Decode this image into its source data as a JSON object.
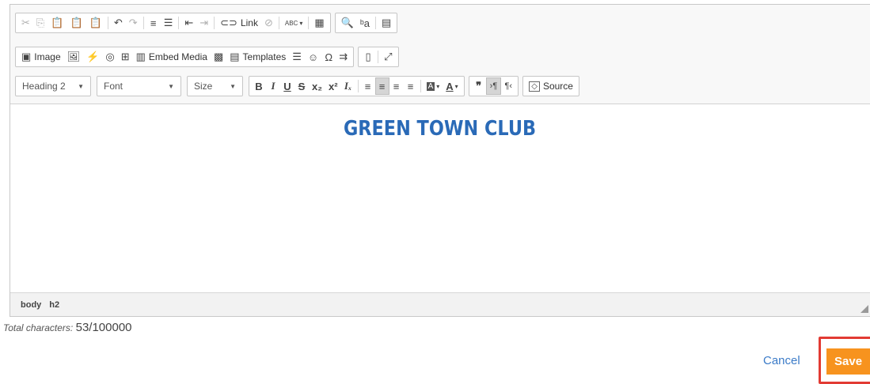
{
  "toolbar": {
    "link_label": "Link",
    "image_label": "Image",
    "embed_media_label": "Embed Media",
    "templates_label": "Templates",
    "source_label": "Source",
    "format_combo": "Heading 2",
    "font_combo": "Font",
    "size_combo": "Size",
    "spell_label": "ABC",
    "omega_label": "Ω"
  },
  "content": {
    "heading": "GREEN TOWN CLUB"
  },
  "elements_path": [
    "body",
    "h2"
  ],
  "counter": {
    "label": "Total characters:",
    "value": "53/100000"
  },
  "actions": {
    "cancel": "Cancel",
    "save": "Save"
  },
  "colors": {
    "heading": "#2a6ab7",
    "save_bg": "#f7931e",
    "highlight": "#e23b33",
    "link": "#3b7bc8"
  }
}
